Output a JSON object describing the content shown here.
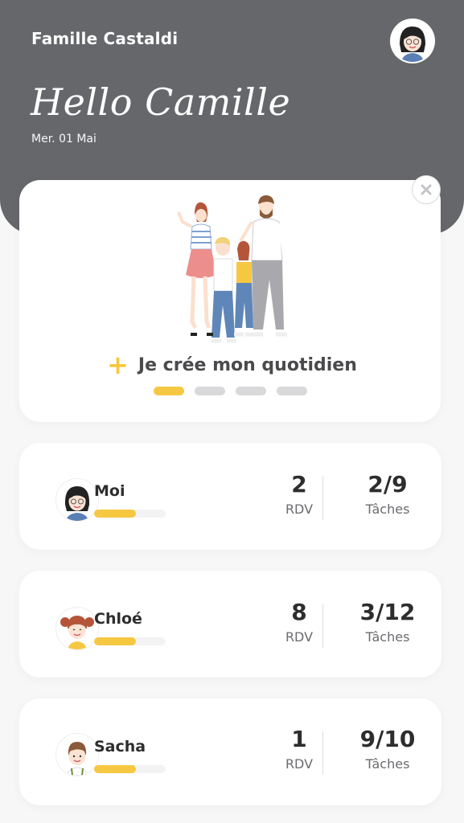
{
  "header": {
    "family_name": "Famille Castaldi",
    "greeting": "Hello Camille",
    "date": "Mer. 01 Mai",
    "background_color": "#66676b"
  },
  "hero_card": {
    "cta_label": "Je crée mon quotidien",
    "cta_icon": "plus-icon",
    "close_icon": "close-icon",
    "pagination_active_index": 0,
    "pagination_count": 4
  },
  "accent_color": "#f6c842",
  "members": [
    {
      "name": "Moi",
      "rdv_count": "2",
      "rdv_label": "RDV",
      "tasks": "2/9",
      "tasks_label": "Tâches",
      "progress": 0.58
    },
    {
      "name": "Chloé",
      "rdv_count": "8",
      "rdv_label": "RDV",
      "tasks": "3/12",
      "tasks_label": "Tâches",
      "progress": 0.58
    },
    {
      "name": "Sacha",
      "rdv_count": "1",
      "rdv_label": "RDV",
      "tasks": "9/10",
      "tasks_label": "Tâches",
      "progress": 0.58
    }
  ]
}
